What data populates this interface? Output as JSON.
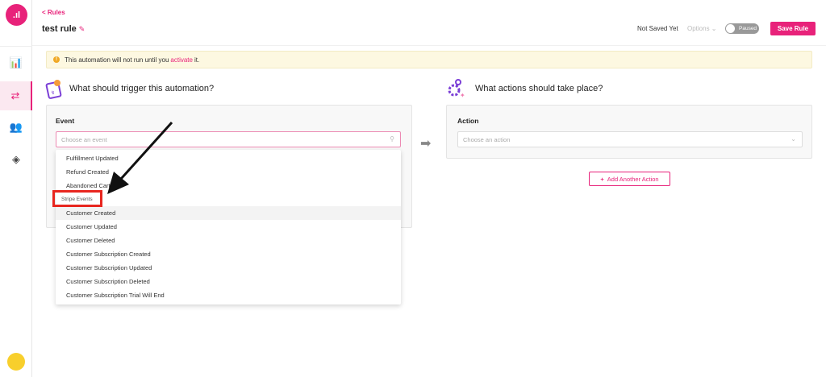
{
  "brand": {
    "accent": "#e8227a"
  },
  "sidebar": {
    "items": [
      {
        "icon": "bar-chart-icon",
        "glyph": "📊"
      },
      {
        "icon": "rules-icon",
        "glyph": "⇄",
        "active": true
      },
      {
        "icon": "users-icon",
        "glyph": "👥"
      },
      {
        "icon": "layers-icon",
        "glyph": "◈"
      }
    ]
  },
  "header": {
    "back_label": "Rules",
    "title": "test rule",
    "status": "Not Saved Yet",
    "options_label": "Options ⌄",
    "toggle_label": "Paused",
    "save_label": "Save Rule"
  },
  "banner": {
    "before": "This automation will not run until you",
    "link": "activate",
    "after": "it."
  },
  "trigger": {
    "title": "What should trigger this automation?",
    "event_label": "Event",
    "event_placeholder": "Choose an event",
    "options_before": [
      "Fulfillment Updated",
      "Refund Created",
      "Abandoned Cart"
    ],
    "group_label": "Stripe Events",
    "options_after": [
      "Customer Created",
      "Customer Updated",
      "Customer Deleted",
      "Customer Subscription Created",
      "Customer Subscription Updated",
      "Customer Subscription Deleted",
      "Customer Subscription Trial Will End"
    ],
    "highlighted": "Customer Created"
  },
  "actions": {
    "title": "What actions should take place?",
    "action_label": "Action",
    "action_placeholder": "Choose an action",
    "add_label": "Add Another Action"
  }
}
